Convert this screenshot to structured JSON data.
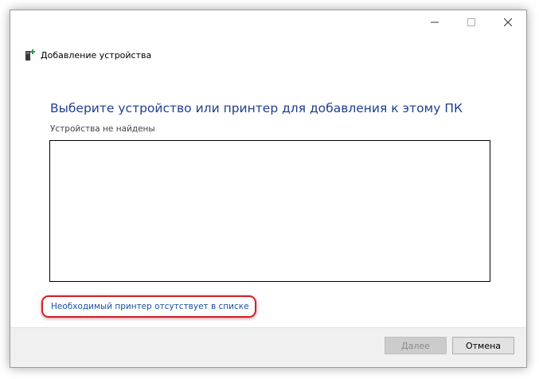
{
  "window": {
    "title": "Добавление устройства"
  },
  "header": {
    "heading": "Выберите устройство или принтер для добавления к этому ПК",
    "subtext": "Устройства не найдены"
  },
  "device_list": {
    "items": []
  },
  "link": {
    "printer_missing": "Необходимый принтер отсутствует в списке"
  },
  "footer": {
    "next_label": "Далее",
    "next_enabled": false,
    "cancel_label": "Отмена"
  },
  "colors": {
    "heading": "#1e3f8f",
    "link": "#1a4fa3",
    "highlight": "#d21f2a"
  }
}
